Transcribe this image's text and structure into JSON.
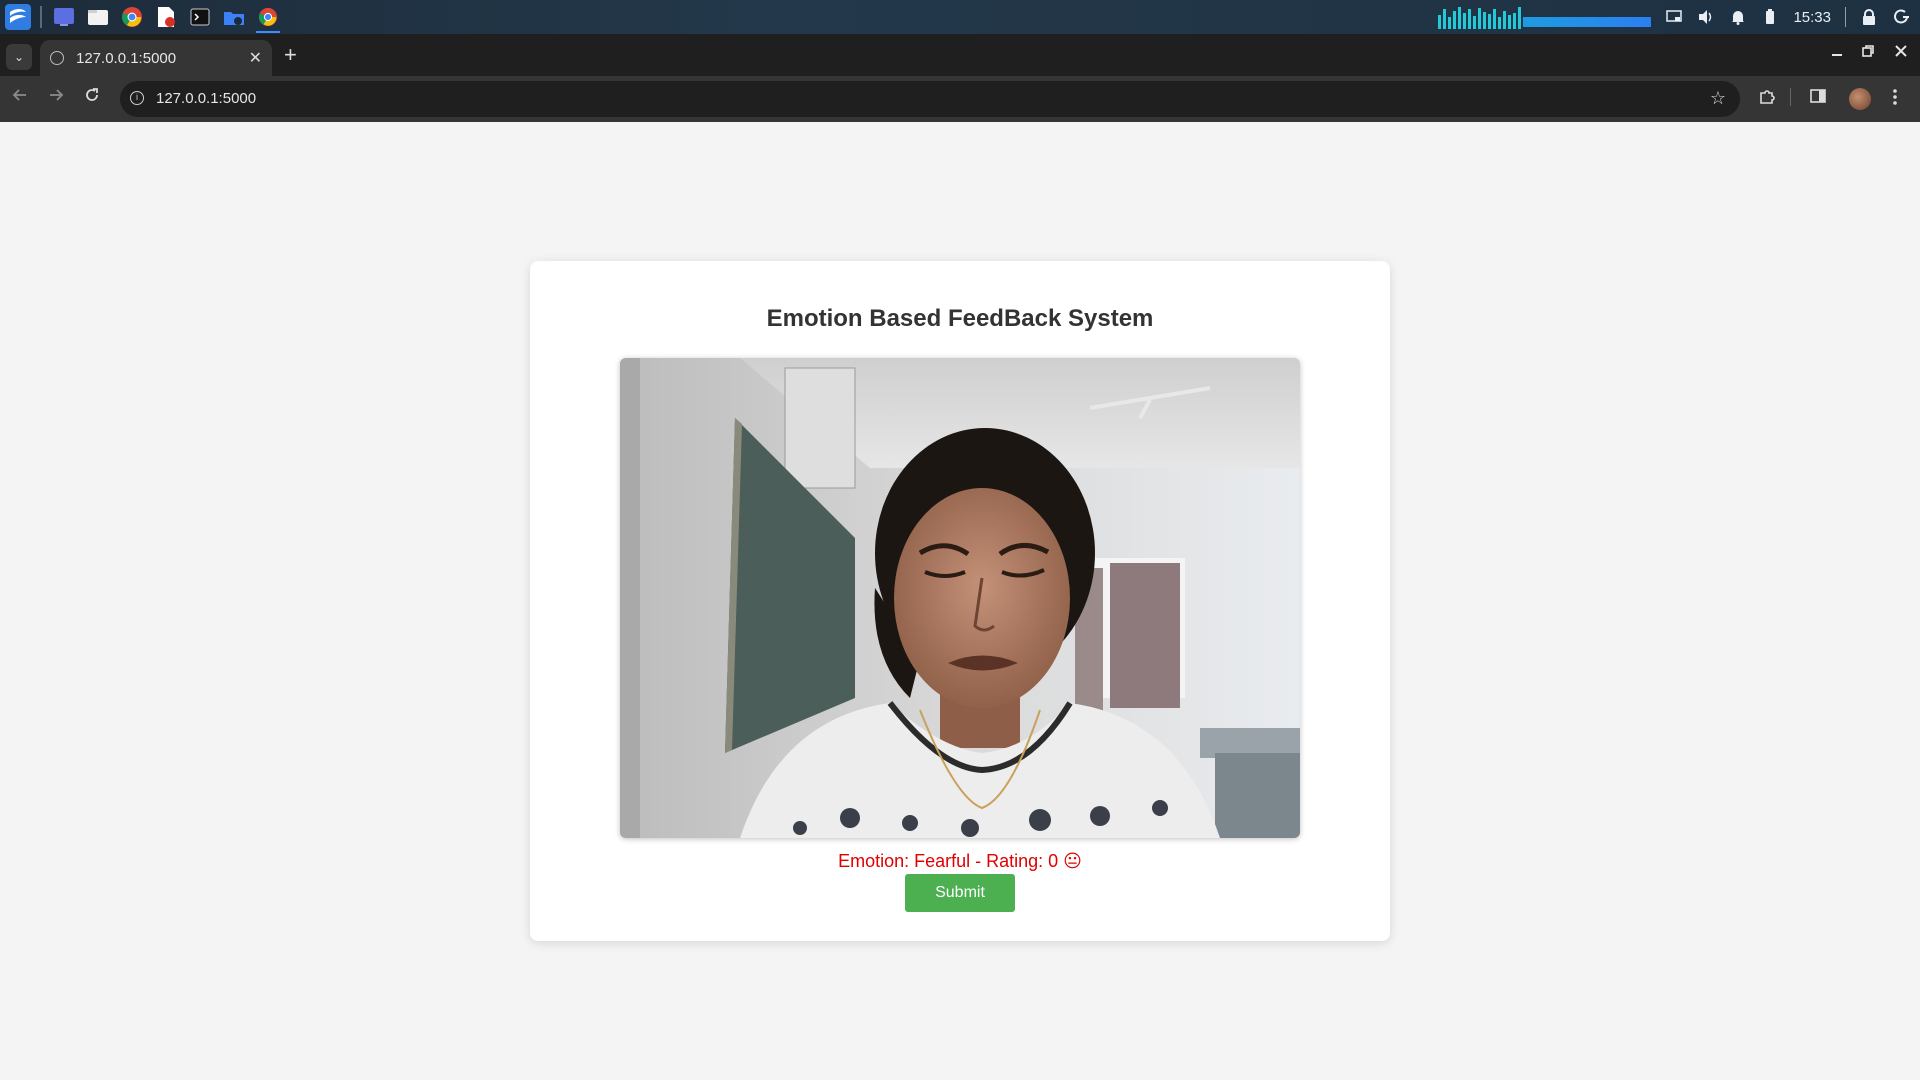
{
  "os": {
    "clock": "15:33",
    "taskbar_apps": [
      "start-menu",
      "desktop",
      "files",
      "chrome",
      "document-viewer",
      "terminal",
      "file-manager",
      "chrome-active"
    ],
    "visualizer_color": "#22c9d9"
  },
  "browser": {
    "tab_title": "127.0.0.1:5000",
    "url": "127.0.0.1:5000",
    "new_tab_label": "+",
    "close_tab_label": "✕"
  },
  "page": {
    "title": "Emotion Based FeedBack System",
    "emotion_text": "Emotion: Fearful - Rating: 0 😐",
    "submit_label": "Submit",
    "video_alt": "Live webcam feed",
    "colors": {
      "emotion_text": "#e00000",
      "submit_bg": "#4caf50",
      "page_bg": "#f4f4f4"
    }
  }
}
